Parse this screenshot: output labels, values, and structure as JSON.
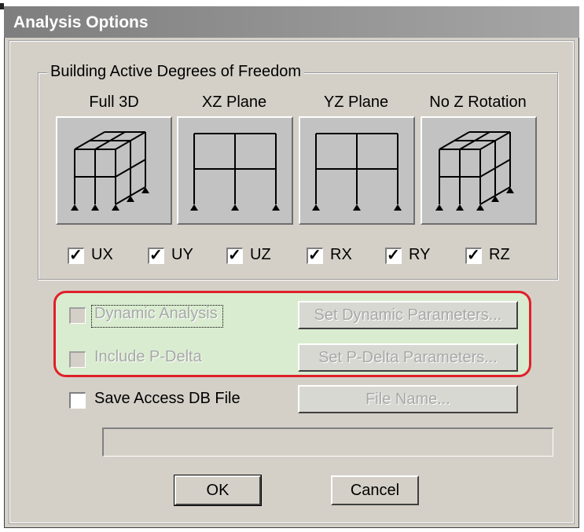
{
  "window": {
    "title": "Analysis Options"
  },
  "dof_group": {
    "legend": "Building Active Degrees of Freedom",
    "options": [
      {
        "label": "Full 3D",
        "icon": "frame-3d-icon"
      },
      {
        "label": "XZ Plane",
        "icon": "frame-xz-plane-icon"
      },
      {
        "label": "YZ Plane",
        "icon": "frame-yz-plane-icon"
      },
      {
        "label": "No Z Rotation",
        "icon": "frame-no-z-rotation-icon"
      }
    ],
    "checkboxes": [
      {
        "label": "UX",
        "checked": true
      },
      {
        "label": "UY",
        "checked": true
      },
      {
        "label": "UZ",
        "checked": true
      },
      {
        "label": "RX",
        "checked": true
      },
      {
        "label": "RY",
        "checked": true
      },
      {
        "label": "RZ",
        "checked": true
      }
    ]
  },
  "dynamic": {
    "label": "Dynamic Analysis",
    "checked": false,
    "enabled": false,
    "button": "Set Dynamic Parameters..."
  },
  "pdelta": {
    "label": "Include P-Delta",
    "checked": false,
    "enabled": false,
    "button": "Set P-Delta Parameters..."
  },
  "access": {
    "label": "Save Access DB File",
    "checked": false,
    "button": "File Name..."
  },
  "file_path": {
    "value": ""
  },
  "footer": {
    "ok": "OK",
    "cancel": "Cancel"
  },
  "colors": {
    "highlight_border": "#e0202a",
    "highlight_fill": "#d9ecd0"
  }
}
